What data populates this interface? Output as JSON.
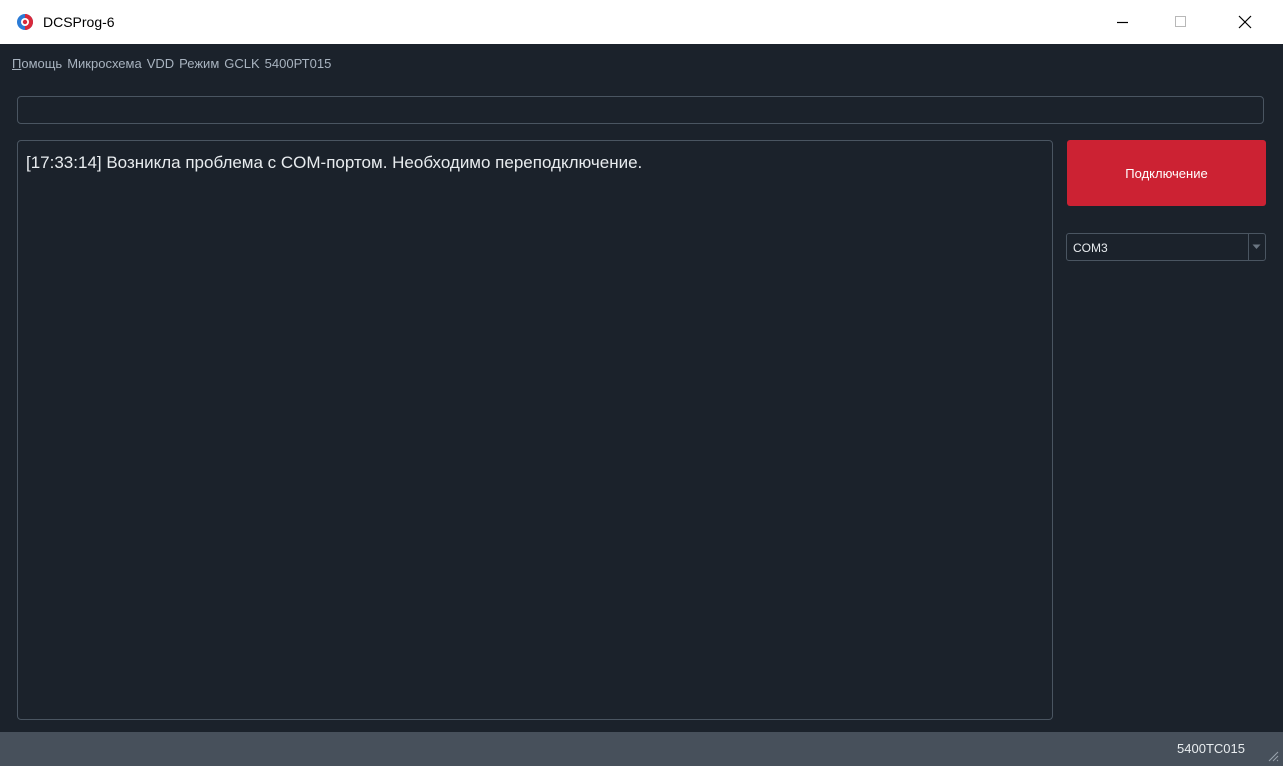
{
  "window": {
    "title": "DCSProg-6"
  },
  "menu": {
    "items": [
      {
        "first": "П",
        "rest": "омощь"
      },
      {
        "first": "",
        "rest": "Микросхема"
      },
      {
        "first": "",
        "rest": "VDD"
      },
      {
        "first": "",
        "rest": "Режим"
      },
      {
        "first": "",
        "rest": "GCLK"
      },
      {
        "first": "",
        "rest": "5400РТ015"
      }
    ]
  },
  "top_field": {
    "value": ""
  },
  "log": {
    "lines": [
      "[17:33:14] Возникла проблема с COM-портом. Необходимо переподключение."
    ]
  },
  "connect_button": {
    "label": "Подключение"
  },
  "port_select": {
    "value": "COM3"
  },
  "status": {
    "chip": "5400TC015"
  },
  "colors": {
    "background": "#1b222b",
    "accent": "#cc2233",
    "statusbar": "#47505b",
    "border": "#4a5561"
  },
  "icons": {
    "app": "dcsprog-logo-icon",
    "minimize": "minimize-icon",
    "maximize": "maximize-icon",
    "close": "close-icon",
    "dropdown": "chevron-down-icon",
    "grip": "resize-grip-icon"
  }
}
